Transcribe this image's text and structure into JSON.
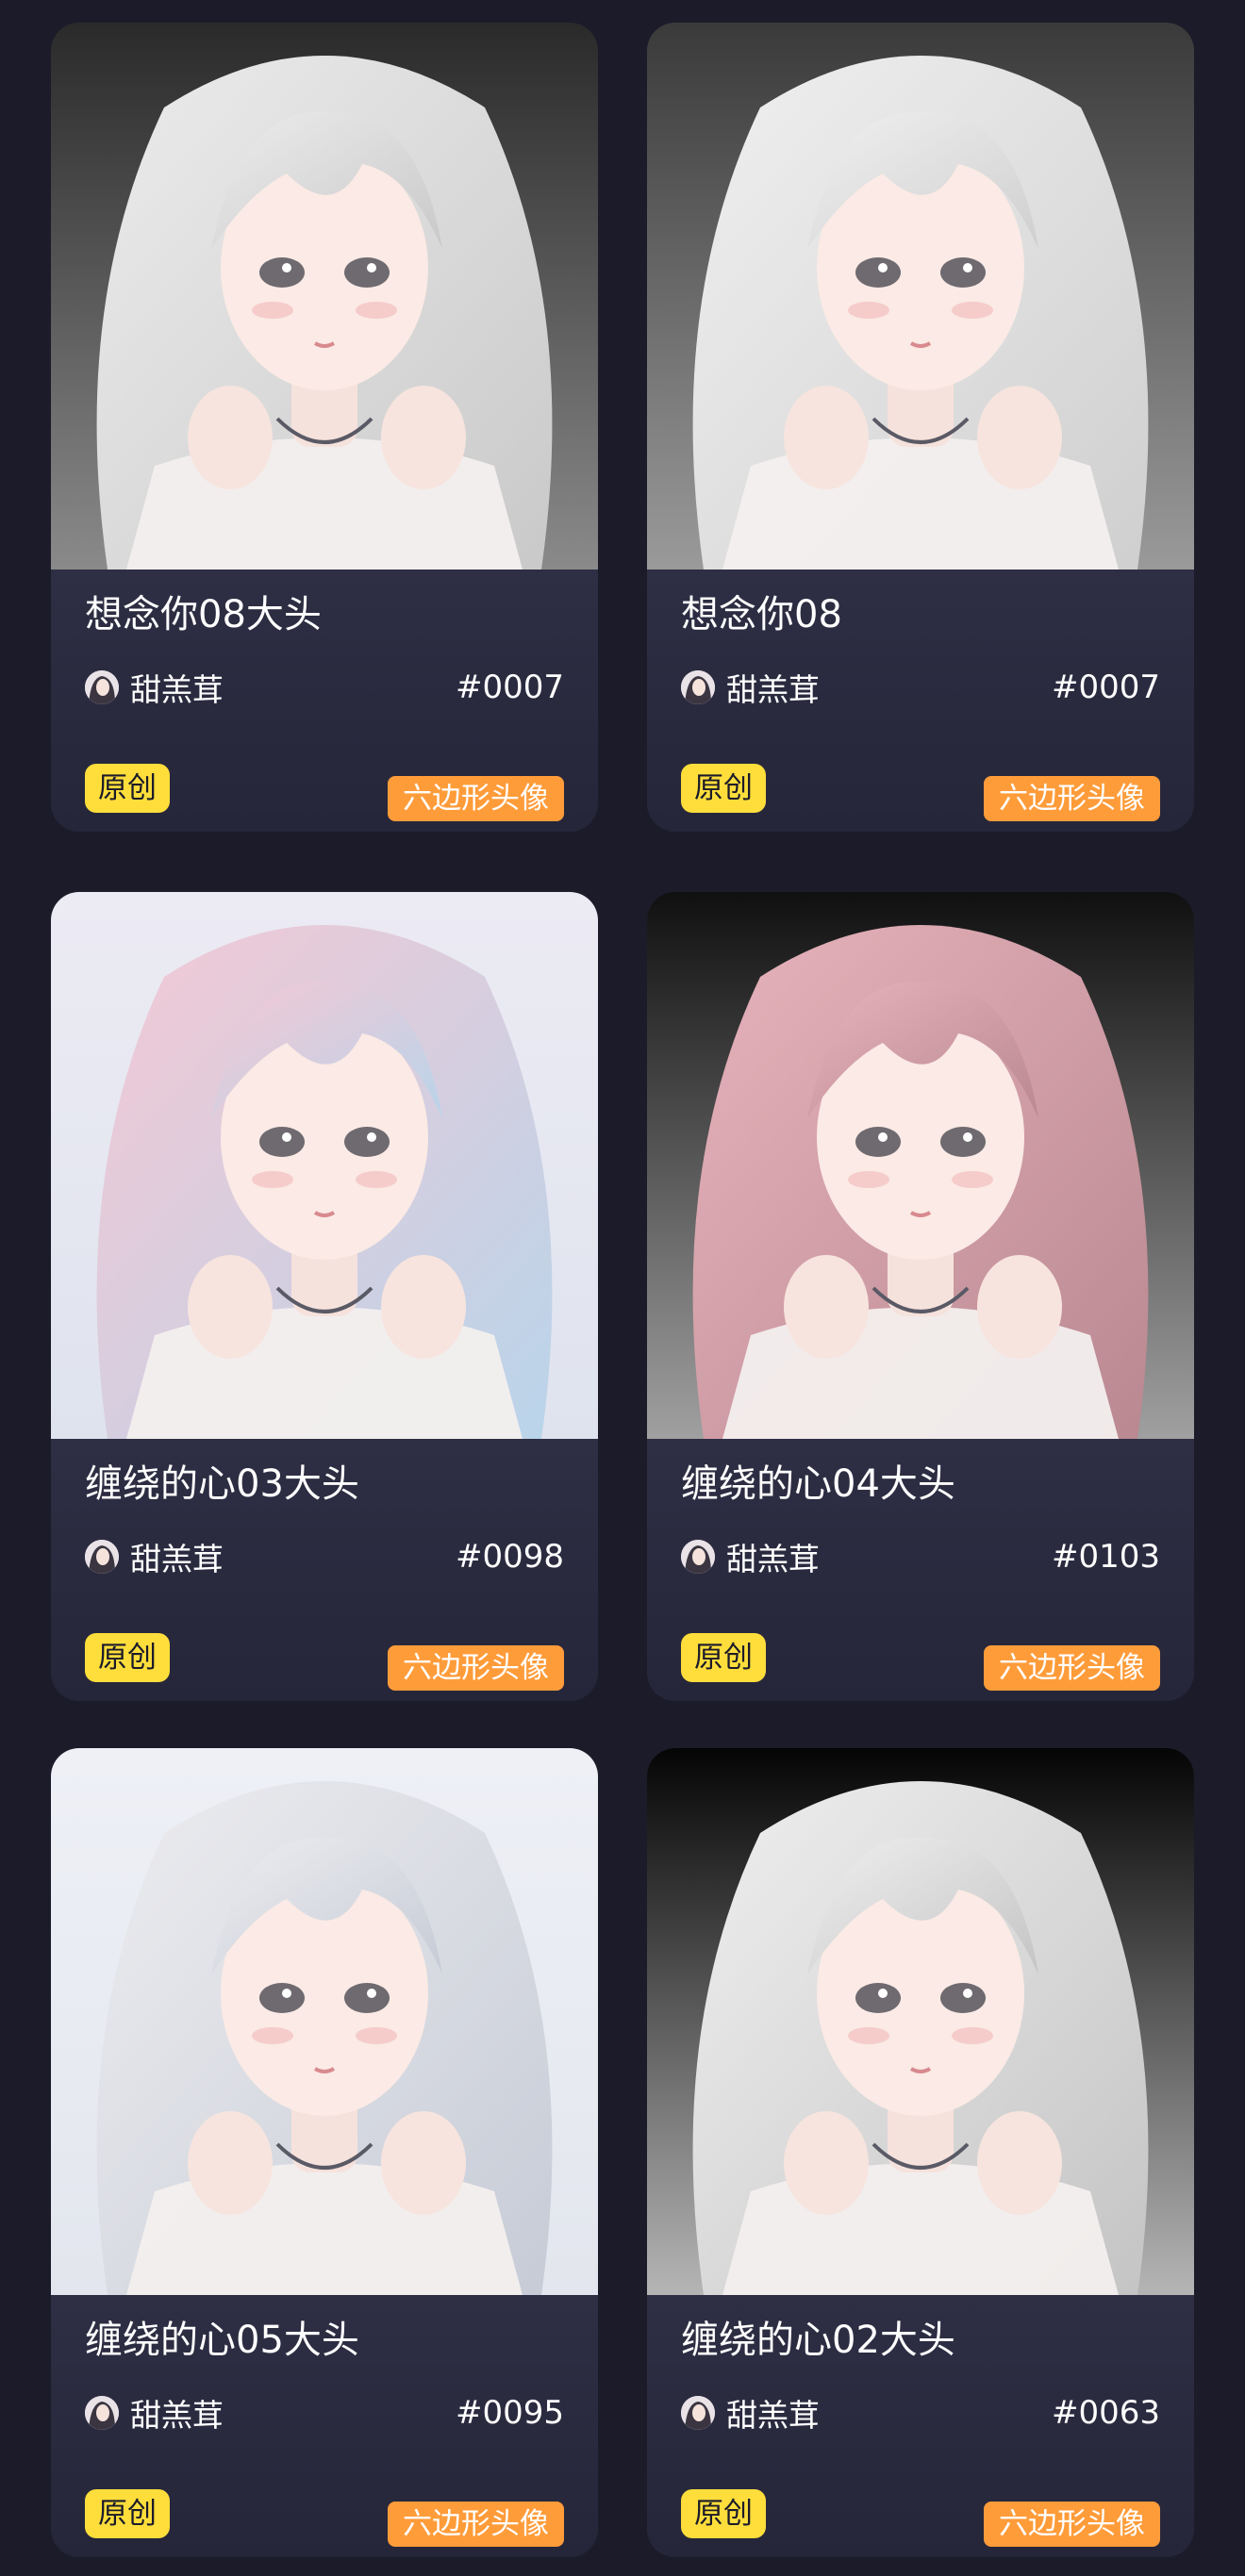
{
  "cards": [
    {
      "title": "想念你08大头",
      "author": "甜羔茸",
      "code": "#0007",
      "badge_original": "原创",
      "badge_type": "六边形头像",
      "bg_top": "#2a2a2a",
      "bg_bottom": "#8a8a8a",
      "hair": "#ececec",
      "hair_shade": "#c9c9c9"
    },
    {
      "title": "想念你08",
      "author": "甜羔茸",
      "code": "#0007",
      "badge_original": "原创",
      "badge_type": "六边形头像",
      "bg_top": "#3a3a3a",
      "bg_bottom": "#9a9a9a",
      "hair": "#f0f0f0",
      "hair_shade": "#cfcfcf"
    },
    {
      "title": "缠绕的心03大头",
      "author": "甜羔茸",
      "code": "#0098",
      "badge_original": "原创",
      "badge_type": "六边形头像",
      "bg_top": "#ecebf4",
      "bg_bottom": "#dfe3ee",
      "hair": "#f4c8d4",
      "hair_shade": "#b9d4ea"
    },
    {
      "title": "缠绕的心04大头",
      "author": "甜羔茸",
      "code": "#0103",
      "badge_original": "原创",
      "badge_type": "六边形头像",
      "bg_top": "#101010",
      "bg_bottom": "#a0a0a0",
      "hair": "#e7b3bc",
      "hair_shade": "#b98890"
    },
    {
      "title": "缠绕的心05大头",
      "author": "甜羔茸",
      "code": "#0095",
      "badge_original": "原创",
      "badge_type": "六边形头像",
      "bg_top": "#eef0f6",
      "bg_bottom": "#e3e6ee",
      "hair": "#ededf0",
      "hair_shade": "#c6cbd6"
    },
    {
      "title": "缠绕的心02大头",
      "author": "甜羔茸",
      "code": "#0063",
      "badge_original": "原创",
      "badge_type": "六边形头像",
      "bg_top": "#050505",
      "bg_bottom": "#b5b5b5",
      "hair": "#efefef",
      "hair_shade": "#c4c4c4"
    }
  ]
}
